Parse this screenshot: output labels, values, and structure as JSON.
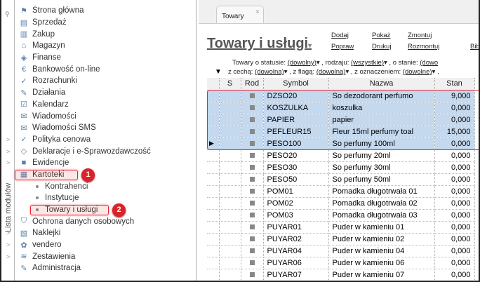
{
  "sidebar": {
    "strip_label": "Lista modułów",
    "modules": [
      {
        "label": "Strona główna",
        "icon": "home-icon"
      },
      {
        "label": "Sprzedaż",
        "icon": "sales-icon"
      },
      {
        "label": "Zakup",
        "icon": "purchase-icon"
      },
      {
        "label": "Magazyn",
        "icon": "warehouse-icon"
      },
      {
        "label": "Finanse",
        "icon": "finance-icon"
      },
      {
        "label": "Bankowość on-line",
        "icon": "bank-icon"
      },
      {
        "label": "Rozrachunki",
        "icon": "settlements-icon"
      },
      {
        "label": "Działania",
        "icon": "actions-icon"
      },
      {
        "label": "Kalendarz",
        "icon": "calendar-icon"
      },
      {
        "label": "Wiadomości",
        "icon": "mail-icon"
      },
      {
        "label": "Wiadomości SMS",
        "icon": "sms-icon"
      },
      {
        "label": "Polityka cenowa",
        "icon": "pricing-icon",
        "expand": true
      },
      {
        "label": "Deklaracje i e-Sprawozdawczość",
        "icon": "declarations-icon",
        "expand": true
      },
      {
        "label": "Ewidencje",
        "icon": "records-icon",
        "expand": true
      },
      {
        "label": "Kartoteki",
        "icon": "files-icon",
        "badge": "1"
      },
      {
        "label": "Kontrahenci",
        "sub": true
      },
      {
        "label": "Instytucje",
        "sub": true
      },
      {
        "label": "Towary i usługi",
        "sub": true,
        "badge": "2"
      },
      {
        "label": "Ochrona danych osobowych",
        "icon": "shield-icon"
      },
      {
        "label": "Naklejki",
        "icon": "stickers-icon",
        "expand": true
      },
      {
        "label": "vendero",
        "icon": "vendero-icon",
        "expand": true
      },
      {
        "label": "Zestawienia",
        "icon": "reports-icon",
        "expand": true
      },
      {
        "label": "Administracja",
        "icon": "admin-icon"
      }
    ]
  },
  "tab": {
    "label": "Towary",
    "close": "×"
  },
  "page": {
    "title": "Towary i usługi",
    "actions": [
      "Dodaj",
      "Popraw",
      "Pokaż",
      "Drukuj",
      "Zmontuj",
      "Rozmontuj",
      "Bibl"
    ],
    "filters": {
      "l1": [
        "Towary o statusie:",
        "(dowolny)",
        ", rodzaju:",
        "(wszystkie)",
        ", o stanie:",
        "(dowo"
      ],
      "l2": [
        "z cechą:",
        "(dowolna)",
        ", z flagą:",
        "(dowolna)",
        ", z oznaczeniem:",
        "(dowolne)",
        ","
      ]
    }
  },
  "table": {
    "columns": [
      "",
      "S",
      "Rod",
      "Symbol",
      "Nazwa",
      "Stan"
    ],
    "rows": [
      {
        "symbol": "DZSO20",
        "name": "So dezodorant perfumo",
        "stan": "9,000",
        "sel": true
      },
      {
        "symbol": "KOSZULKA",
        "name": "koszulka",
        "stan": "0,000",
        "sel": true
      },
      {
        "symbol": "PAPIER",
        "name": "papier",
        "stan": "0,000",
        "sel": true
      },
      {
        "symbol": "PEFLEUR15",
        "name": "Fleur 15ml perfumy toal",
        "stan": "15,000",
        "sel": true
      },
      {
        "symbol": "PESO100",
        "name": "So perfumy 100ml",
        "stan": "0,000",
        "sel": true,
        "current": true
      },
      {
        "symbol": "PESO20",
        "name": "So perfumy 20ml",
        "stan": "0,000"
      },
      {
        "symbol": "PESO30",
        "name": "So perfumy 30ml",
        "stan": "0,000"
      },
      {
        "symbol": "PESO50",
        "name": "So perfumy 50ml",
        "stan": "0,000"
      },
      {
        "symbol": "POM01",
        "name": "Pomadka długotrwała 01",
        "stan": "0,000"
      },
      {
        "symbol": "POM02",
        "name": "Pomadka długotrwała 02",
        "stan": "0,000"
      },
      {
        "symbol": "POM03",
        "name": "Pomadka długotrwała 03",
        "stan": "0,000"
      },
      {
        "symbol": "PUYAR01",
        "name": "Puder w kamieniu 01",
        "stan": "0,000"
      },
      {
        "symbol": "PUYAR02",
        "name": "Puder w kamieniu 02",
        "stan": "0,000"
      },
      {
        "symbol": "PUYAR04",
        "name": "Puder w kamieniu 04",
        "stan": "0,000"
      },
      {
        "symbol": "PUYAR06",
        "name": "Puder w kamieniu 06",
        "stan": "0,000"
      },
      {
        "symbol": "PUYAR07",
        "name": "Puder w kamieniu 07",
        "stan": "0,000"
      }
    ]
  },
  "colors": {
    "selection": "#c4d8ee",
    "highlight": "#e22233",
    "badge": "#d9232b"
  }
}
